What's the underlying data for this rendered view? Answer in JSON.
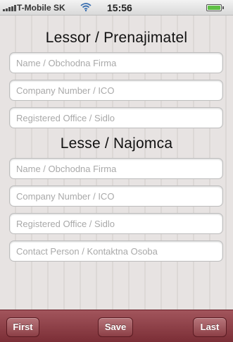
{
  "status_bar": {
    "carrier": "T-Mobile SK",
    "time": "15:56",
    "icons": [
      "signal-icon",
      "wifi-icon",
      "battery-icon"
    ],
    "battery_color": "#5fbf45"
  },
  "lessor": {
    "title": "Lessor / Prenajimatel",
    "fields": {
      "name": {
        "value": "",
        "placeholder": "Name / Obchodna Firma"
      },
      "company_number": {
        "value": "",
        "placeholder": "Company Number / ICO"
      },
      "registered_office": {
        "value": "",
        "placeholder": "Registered Office / Sidlo"
      }
    }
  },
  "lessee": {
    "title": "Lesse / Najomca",
    "fields": {
      "name": {
        "value": "",
        "placeholder": "Name / Obchodna Firma"
      },
      "company_number": {
        "value": "",
        "placeholder": "Company Number / ICO"
      },
      "registered_office": {
        "value": "",
        "placeholder": "Registered Office / Sidlo"
      },
      "contact_person": {
        "value": "",
        "placeholder": "Contact Person / Kontaktna Osoba"
      }
    }
  },
  "toolbar": {
    "first_label": "First",
    "save_label": "Save",
    "last_label": "Last",
    "color": "#8c3f46"
  }
}
